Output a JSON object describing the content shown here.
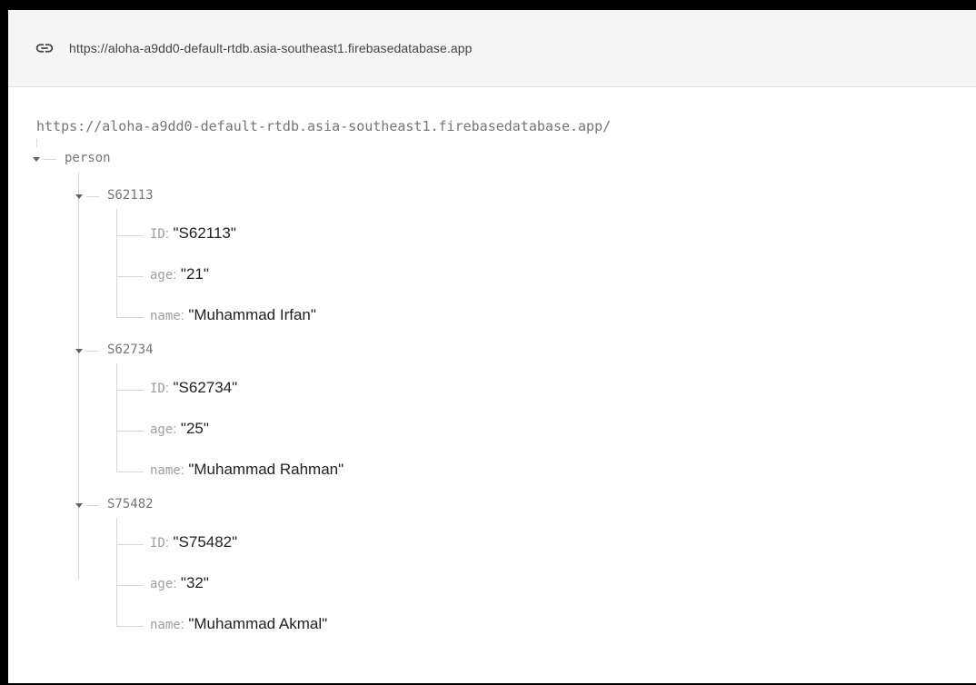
{
  "url_bar": {
    "icon": "link-icon",
    "url": "https://aloha-a9dd0-default-rtdb.asia-southeast1.firebasedatabase.app"
  },
  "tree": {
    "root_url": "https://aloha-a9dd0-default-rtdb.asia-southeast1.firebasedatabase.app/",
    "root_key": "person",
    "records": [
      {
        "key": "S62113",
        "fields": [
          {
            "key": "ID",
            "value": "\"S62113\""
          },
          {
            "key": "age",
            "value": "\"21\""
          },
          {
            "key": "name",
            "value": "\"Muhammad Irfan\""
          }
        ]
      },
      {
        "key": "S62734",
        "fields": [
          {
            "key": "ID",
            "value": "\"S62734\""
          },
          {
            "key": "age",
            "value": "\"25\""
          },
          {
            "key": "name",
            "value": "\"Muhammad Rahman\""
          }
        ]
      },
      {
        "key": "S75482",
        "fields": [
          {
            "key": "ID",
            "value": "\"S75482\""
          },
          {
            "key": "age",
            "value": "\"32\""
          },
          {
            "key": "name",
            "value": "\"Muhammad Akmal\""
          }
        ]
      }
    ]
  },
  "colors": {
    "border": "#000000",
    "url_bar_bg": "#f5f5f5",
    "tree_line": "#d6d6d6",
    "key_text": "#9e9e9e",
    "value_text": "#212121"
  }
}
